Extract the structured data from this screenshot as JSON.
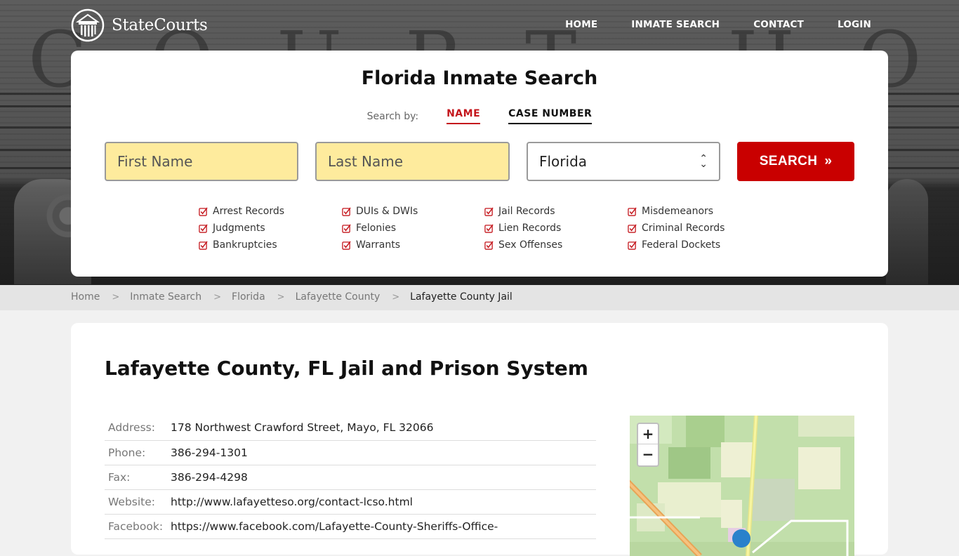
{
  "brand": {
    "name": "StateCourts"
  },
  "nav": [
    {
      "label": "HOME"
    },
    {
      "label": "INMATE SEARCH"
    },
    {
      "label": "CONTACT"
    },
    {
      "label": "LOGIN"
    }
  ],
  "hero": {
    "background_letters": "COURT HOUSE"
  },
  "search": {
    "title": "Florida Inmate Search",
    "search_by_label": "Search by:",
    "tabs": [
      {
        "label": "NAME",
        "active": true
      },
      {
        "label": "CASE NUMBER",
        "active": false
      }
    ],
    "first_name_placeholder": "First Name",
    "last_name_placeholder": "Last Name",
    "state_selected": "Florida",
    "button_label": "SEARCH",
    "button_icon": "»",
    "record_types": [
      "Arrest Records",
      "DUIs & DWIs",
      "Jail Records",
      "Misdemeanors",
      "Judgments",
      "Felonies",
      "Lien Records",
      "Criminal Records",
      "Bankruptcies",
      "Warrants",
      "Sex Offenses",
      "Federal Dockets"
    ]
  },
  "breadcrumb": [
    {
      "label": "Home"
    },
    {
      "label": "Inmate Search"
    },
    {
      "label": "Florida"
    },
    {
      "label": "Lafayette County"
    },
    {
      "label": "Lafayette County Jail",
      "current": true
    }
  ],
  "facility": {
    "title": "Lafayette County, FL Jail and Prison System",
    "details": [
      {
        "key": "Address:",
        "value": "178 Northwest Crawford Street, Mayo, FL 32066",
        "link": false
      },
      {
        "key": "Phone:",
        "value": "386-294-1301",
        "link": false
      },
      {
        "key": "Fax:",
        "value": "386-294-4298",
        "link": false
      },
      {
        "key": "Website:",
        "value": "http://www.lafayetteso.org/contact-lcso.html",
        "link": true
      },
      {
        "key": "Facebook:",
        "value": "https://www.facebook.com/Lafayette-County-Sheriffs-Office-",
        "link": true
      }
    ]
  },
  "map": {
    "zoom_in": "+",
    "zoom_out": "−"
  },
  "colors": {
    "accent": "#c90000",
    "input_bg": "#feeb9d",
    "check": "#c4161c"
  }
}
